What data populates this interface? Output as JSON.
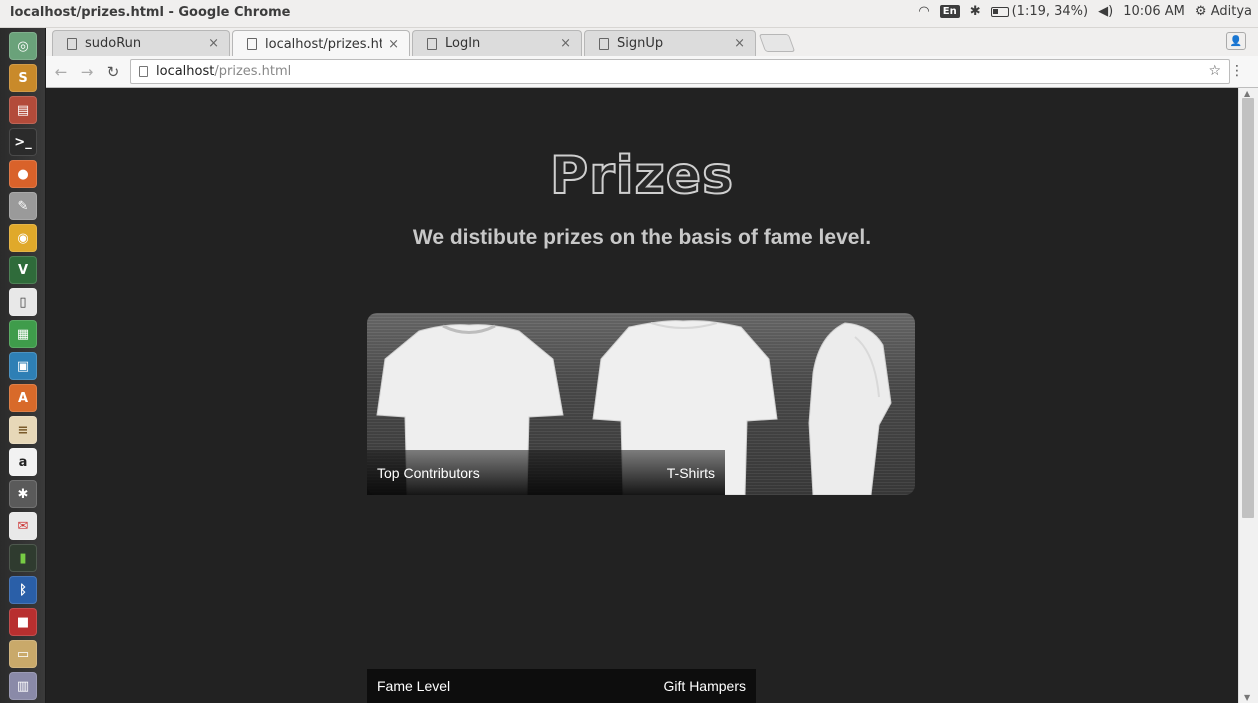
{
  "window": {
    "title": "localhost/prizes.html - Google Chrome",
    "tray": {
      "lang": "En",
      "battery": "(1:19, 34%)",
      "time": "10:06 AM",
      "user": "Aditya"
    }
  },
  "tabs": [
    {
      "label": "sudoRun"
    },
    {
      "label": "localhost/prizes.html"
    },
    {
      "label": "LogIn"
    },
    {
      "label": "SignUp"
    }
  ],
  "address": {
    "host": "localhost",
    "path": "/prizes.html"
  },
  "page": {
    "title": "Prizes",
    "subtitle": "We distibute prizes on the basis of fame level.",
    "card1": {
      "left": "Top Contributors",
      "right": "T-Shirts"
    },
    "card2": {
      "left": "Fame Level",
      "right": "Gift Hampers"
    }
  },
  "colors": {
    "page_bg": "#222222",
    "title_outline": "#cfcfcf",
    "subtitle": "#c8c8c8"
  },
  "launcher_icons": [
    "dash-icon",
    "sublime-icon",
    "files-icon",
    "terminal-icon",
    "firefox-icon",
    "text-editor-icon",
    "chrome-icon",
    "vim-icon",
    "writer-icon",
    "calc-icon",
    "impress-icon",
    "software-center-icon",
    "document-icon",
    "amazon-icon",
    "settings-icon",
    "gmail-icon",
    "battery-app-icon",
    "bluetooth-icon",
    "media-icon",
    "drive-icon",
    "trash-icon"
  ]
}
